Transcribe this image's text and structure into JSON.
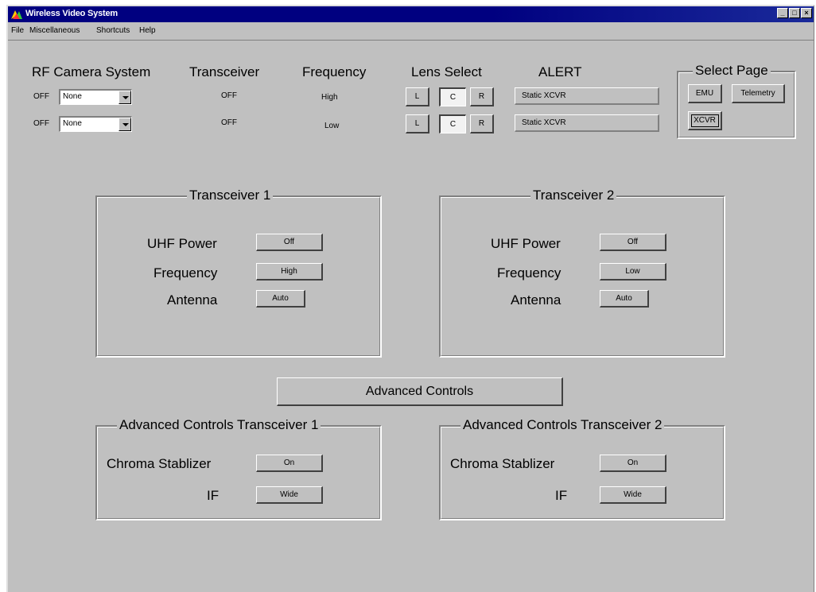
{
  "window": {
    "title": "Wireless Video System"
  },
  "menu": {
    "file": "File",
    "misc": "Miscellaneous",
    "shortcuts": "Shortcuts",
    "help": "Help"
  },
  "header": {
    "rf_camera_system": "RF Camera System",
    "transceiver": "Transceiver",
    "frequency": "Frequency",
    "lens_select": "Lens Select",
    "alert": "ALERT"
  },
  "rows": [
    {
      "state": "OFF",
      "camera": "None",
      "transceiver": "OFF",
      "frequency": "High",
      "lens": [
        "L",
        "C",
        "R"
      ],
      "alert": "Static XCVR"
    },
    {
      "state": "OFF",
      "camera": "None",
      "transceiver": "OFF",
      "frequency": "Low",
      "lens": [
        "L",
        "C",
        "R"
      ],
      "alert": "Static XCVR"
    }
  ],
  "select_page": {
    "title": "Select Page",
    "emu": "EMU",
    "telemetry": "Telemetry",
    "xcvr": "XCVR"
  },
  "transceivers": [
    {
      "title": "Transceiver 1",
      "uhf_label": "UHF Power",
      "uhf": "Off",
      "freq_label": "Frequency",
      "freq": "High",
      "antenna_label": "Antenna",
      "antenna": "Auto"
    },
    {
      "title": "Transceiver 2",
      "uhf_label": "UHF Power",
      "uhf": "Off",
      "freq_label": "Frequency",
      "freq": "Low",
      "antenna_label": "Antenna",
      "antenna": "Auto"
    }
  ],
  "advanced_button": "Advanced Controls",
  "advanced": [
    {
      "title": "Advanced Controls  Transceiver 1",
      "chroma_label": "Chroma Stablizer",
      "chroma": "On",
      "if_label": "IF",
      "if": "Wide"
    },
    {
      "title": "Advanced Controls  Transceiver 2",
      "chroma_label": "Chroma Stablizer",
      "chroma": "On",
      "if_label": "IF",
      "if": "Wide"
    }
  ]
}
